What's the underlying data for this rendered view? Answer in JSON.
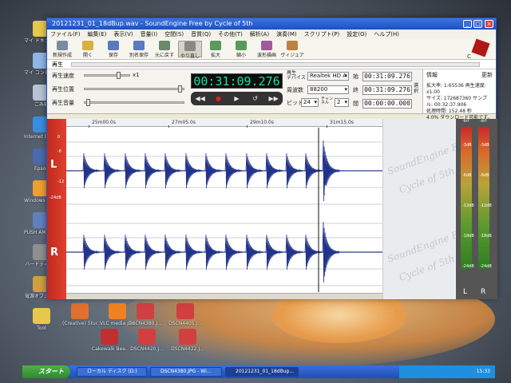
{
  "window": {
    "title": "20121231_01_18dBup.wav - SoundEngine Free by Cycle of 5th",
    "controls": [
      "_",
      "□",
      "×"
    ]
  },
  "menu": [
    "ファイル(F)",
    "編集(E)",
    "表示(V)",
    "音量(I)",
    "空間(S)",
    "音質(Q)",
    "その他(T)",
    "解析(A)",
    "演奏(M)",
    "スクリプト(P)",
    "設定(O)",
    "ヘルプ(H)"
  ],
  "toolbar": {
    "buttons": [
      "新規作成",
      "開く",
      "保存",
      "別名保存",
      "元に戻す",
      "やり直し",
      "拡大",
      "縮小",
      "波形描画",
      "ヴィジュアル"
    ],
    "logo_text": "C"
  },
  "play_label": "再生",
  "panel": {
    "speed_label": "再生速度",
    "speed_value": "x1",
    "position_label": "再生位置",
    "volume_label": "再生音量",
    "time": "00:31:09.276",
    "transport": [
      "◀◀",
      "●",
      "▶",
      "↺",
      "▶▶"
    ],
    "device_label": "再生\nデバイス",
    "device_value": "Realtek HD A",
    "freq_label": "周波数",
    "freq_value": "88200",
    "bit_label": "ビット",
    "bit_value": "24",
    "ch_label": "チャン\nネル",
    "ch_value": "2",
    "start_label": "始",
    "start_value": "00:31:09.276",
    "end_label": "終",
    "end_value": "00:31:09.276",
    "span_label": "間",
    "span_value": "00:00:00.000",
    "select_label": "選択",
    "info_title": "情報",
    "info_refresh": "更新",
    "info_lines": [
      "拡大率: 1:65536 再生速度: x1.00",
      "サイズ: 172687360 サンプル: 00:32:37.906",
      "処理時間: 152.48 秒",
      "4.0% ダウンロード可能です。"
    ]
  },
  "ruler_ticks": [
    "25m00.0s",
    "27m05.0s",
    "29m10.0s",
    "31m15.0s"
  ],
  "channels": [
    "L",
    "R"
  ],
  "db_labels": [
    "0",
    "-6",
    "-12",
    "-24dB"
  ],
  "brand_text": [
    "SoundEngine Free",
    "Cycle of 5th"
  ],
  "meters": {
    "headers": [
      "-Inf",
      "-Inf"
    ],
    "db_marks": [
      "-3dB",
      "-6dB",
      "-12dB",
      "-18dB",
      "-24dB"
    ],
    "labels": [
      "L",
      "R"
    ]
  },
  "desktop_icons": [
    {
      "label": "マイ ドキュメント",
      "color": "#e8c84a"
    },
    {
      "label": "マイ コンピュータ",
      "color": "#8fb6e6"
    },
    {
      "label": "ごみ箱",
      "color": "#b8c4d4"
    },
    {
      "label": "Internet Explorer",
      "color": "#3a8ee0"
    },
    {
      "label": "Epson",
      "color": "#4a6ab0"
    },
    {
      "label": "Windows Media Player",
      "color": "#f0a030"
    },
    {
      "label": "PUSH AM Utility",
      "color": "#6080c0"
    },
    {
      "label": "ハードディスク",
      "color": "#909090"
    },
    {
      "label": "電源オプション",
      "color": "#d0a040"
    },
    {
      "label": "Tool",
      "color": "#e8c84a"
    }
  ],
  "bottom_icons": [
    {
      "label": "(Creative) Studio Stud...",
      "color": "#e07030"
    },
    {
      "label": "VLC media player",
      "color": "#f08020"
    },
    {
      "label": "DSCN4380.J...",
      "color": "#d04040"
    },
    {
      "label": "DSCN4405.J...",
      "color": "#d04040"
    },
    {
      "label": "Cakewalk Bee...",
      "color": "#c03030"
    },
    {
      "label": "DSCN4420.J...",
      "color": "#d04040"
    },
    {
      "label": "DSCN4422.J...",
      "color": "#d04040"
    }
  ],
  "taskbar": {
    "start": "スタート",
    "tasks": [
      "ローカル ディスク (D:)",
      "DSCN4380.JPG - Wi...",
      "20121231_01_18dBup..."
    ],
    "clock": "15:33"
  }
}
